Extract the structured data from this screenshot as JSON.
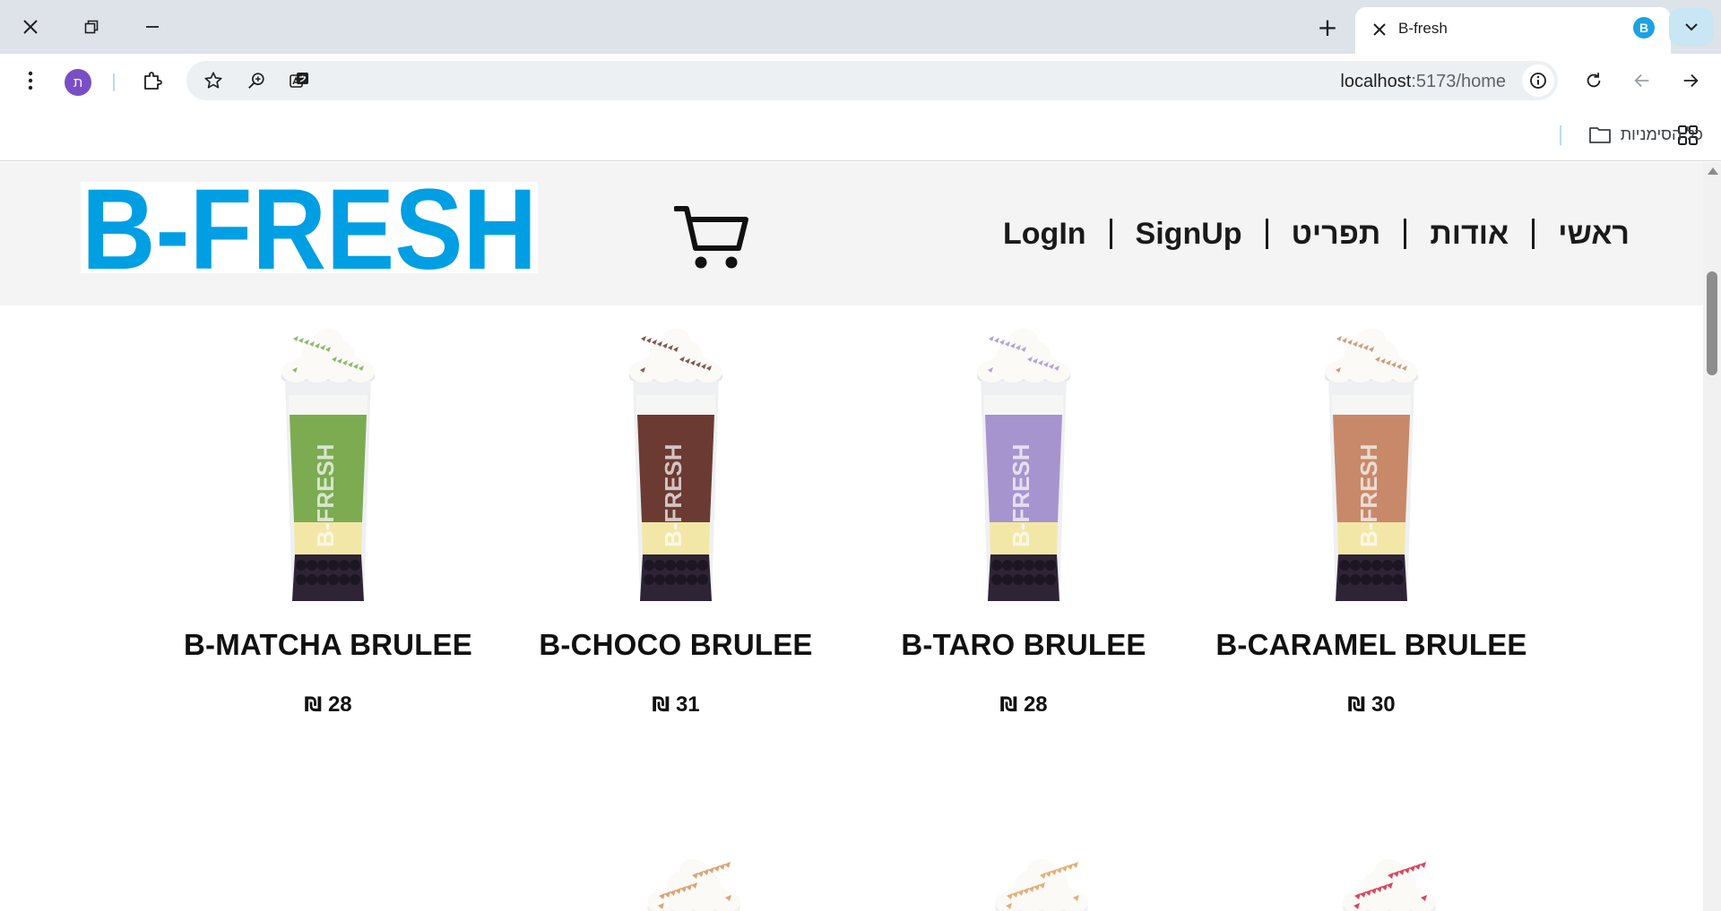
{
  "browser": {
    "tab_title": "B-fresh",
    "tab_favicon_letter": "B",
    "profile_letter": "ת",
    "url_host": "localhost",
    "url_path": ":5173/home",
    "bookmarks_all": "כל הסימניות"
  },
  "site": {
    "logo_text": "B-FRESH",
    "brand_color": "#009fe3",
    "nav": [
      "ראשי",
      "אודות",
      "תפריט",
      "SignUp",
      "LogIn"
    ]
  },
  "products": [
    {
      "name": "B-MATCHA BRULEE",
      "price": "28",
      "currency": "₪",
      "flavor_color": "#7cab52"
    },
    {
      "name": "B-CHOCO BRULEE",
      "price": "31",
      "currency": "₪",
      "flavor_color": "#6b3b33"
    },
    {
      "name": "B-TARO BRULEE",
      "price": "28",
      "currency": "₪",
      "flavor_color": "#a694cf"
    },
    {
      "name": "B-CARAMEL BRULEE",
      "price": "30",
      "currency": "₪",
      "flavor_color": "#c7896a"
    }
  ]
}
